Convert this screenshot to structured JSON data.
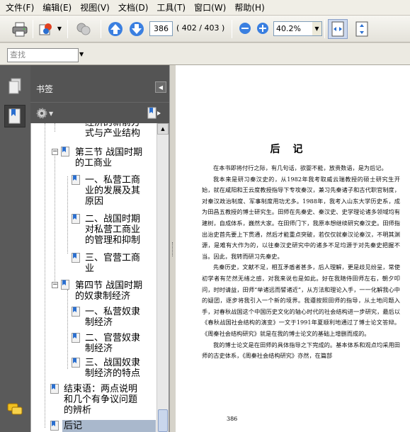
{
  "menu": [
    "文件(F)",
    "编辑(E)",
    "视图(V)",
    "文档(D)",
    "工具(T)",
    "窗口(W)",
    "帮助(H)"
  ],
  "toolbar": {
    "page_current": "386",
    "page_total": "( 402 / 403 )",
    "zoom": "40.2%"
  },
  "find": {
    "placeholder": "查找"
  },
  "bookmarks": {
    "title": "书签",
    "items": [
      {
        "label": "经济的新前方\n式与产业结构"
      },
      {
        "label": "第三节 战国时期\n的工商业"
      },
      {
        "label": "一、私营工商\n业的发展及其\n原因"
      },
      {
        "label": "二、战国时期\n对私营工商业\n的管理和抑制"
      },
      {
        "label": "三、官营工商\n业"
      },
      {
        "label": "第四节 战国时期\n的奴隶制经济"
      },
      {
        "label": "一、私营奴隶\n制经济"
      },
      {
        "label": "二、官营奴隶\n制经济"
      },
      {
        "label": "三、战国奴隶\n制经济的特点"
      },
      {
        "label": "结束语：两点说明\n和几个有争议问题\n的辨析"
      },
      {
        "label": "后记"
      }
    ]
  },
  "document": {
    "heading": "后记",
    "paragraphs": [
      "在本书即将付行之际，有几句话，欲婴不能，放贵数语，是为后记。",
      "我本来是研习秦汉史的，从1982年我考取威云瑞教授的硕士研究生开始，就在咸阳和王云度教授指导下专攻秦汉，兼习先秦诸子和古代职官制度，对秦汉政治制度、军事制度用功尤多。1988年，我考入山东大学历史系，成为田昌五教授的博士研究生。田师在先秦史、秦汉史、史学理论诸多领域均有建树，自成体系，巍然大家。在田师门下，我原本想继续研究秦汉史。田师指出治史首先要上下贯通，然后才能重点突破，若仅仅就秦汉论秦汉，不明其渊源，是难有大作为的，以往秦汉史研究中的诸多不足均源于对先秦史把握不当。因此，我转而研习先秦史。",
      "先秦历史，文献不足，相互矛盾者甚多，后人理解，更是歧见纷呈，常使初学者有茫然无绪之感，对我来说也是如此。好在我随侍田师左右，朝夕叩问，时时请益，田师“举诸远而譬诸近”，从方法和理论入手，一一化解我心中的疑团，逐步将我引入一个新的境界。我遵按照田师的指导，从土地问题入手，对春秋战国这个中国历史文化的轴心时代的社会结构进一步研究，最后以《春秋战国社会结构的演变》一文于1991年夏顺利地通过了博士论文答辩。《周秦社会结构研究》就是在我的博士论文的基础上增删而成的。",
      "我的博士论文是在田师的具体指导之下完成的。基本体系和观点均采用田师的古史体系，《周秦社会结构研究》亦然，在篇部"
    ],
    "page_number": "386"
  }
}
